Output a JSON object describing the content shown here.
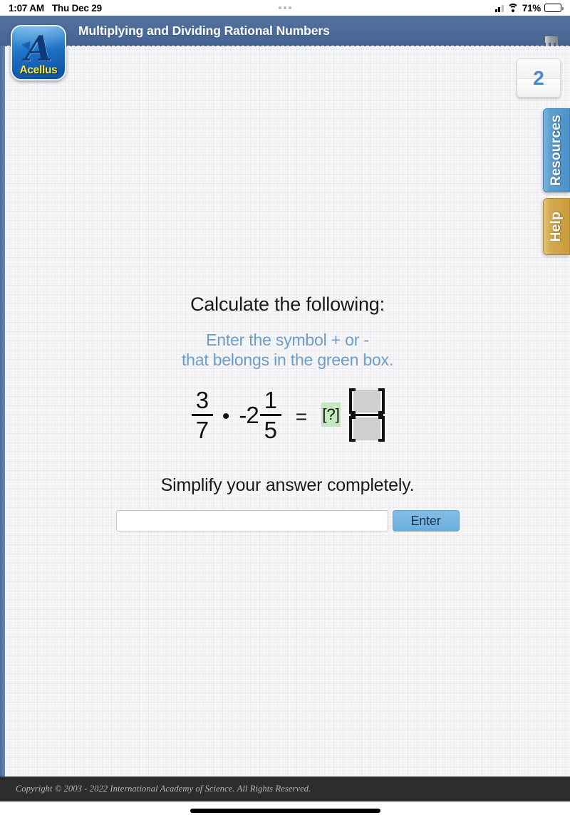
{
  "status_bar": {
    "time": "1:07 AM",
    "date": "Thu Dec 29",
    "battery_percent": "71%",
    "icons": [
      "cellular-signal-icon",
      "wifi-icon",
      "battery-icon"
    ]
  },
  "header": {
    "title": "Multiplying and Dividing Rational Numbers",
    "exit_icon": "exit-door-icon",
    "background_color": "#4a6a99"
  },
  "logo": {
    "mark": "A",
    "wordmark": "Acellus"
  },
  "sidebar": {
    "counter_value": "2",
    "tabs": [
      {
        "label": "Resources",
        "color": "#5e9fd0"
      },
      {
        "label": "Help",
        "color": "#d4a94f"
      }
    ]
  },
  "lesson": {
    "title": "Calculate the following:",
    "instruction_line1": "Enter the symbol + or -",
    "instruction_line2": "that belongs in the green box.",
    "simplify_note": "Simplify your answer completely.",
    "expression": {
      "left_fraction": {
        "numerator": "3",
        "denominator": "7"
      },
      "operator": "•",
      "mixed_number": {
        "whole": "-2",
        "numerator": "1",
        "denominator": "5"
      },
      "equals": "=",
      "sign_placeholder": "[?]",
      "answer_fraction": {
        "numerator_placeholder": "[  ]",
        "denominator_placeholder": "[  ]"
      },
      "sign_box_color": "#c3e8bf",
      "answer_box_color": "#cfcfcf"
    }
  },
  "answer": {
    "input_value": "",
    "input_placeholder": "",
    "enter_label": "Enter"
  },
  "footer": {
    "copyright": "Copyright © 2003 - 2022 International Academy of Science.  All Rights Reserved."
  }
}
